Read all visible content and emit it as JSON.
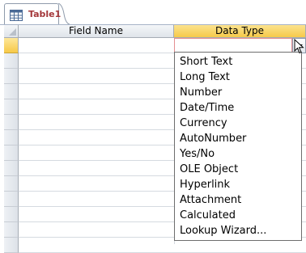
{
  "tab": {
    "label": "Table1",
    "icon": "table-icon"
  },
  "columns": {
    "field_name": "Field Name",
    "data_type": "Data Type"
  },
  "colors": {
    "active_header": "#f7c948",
    "tab_label": "#a4373a",
    "active_cell_border": "#e48f91"
  },
  "dropdown": {
    "options": [
      "Short Text",
      "Long Text",
      "Number",
      "Date/Time",
      "Currency",
      "AutoNumber",
      "Yes/No",
      "OLE Object",
      "Hyperlink",
      "Attachment",
      "Calculated",
      "Lookup Wizard..."
    ]
  }
}
